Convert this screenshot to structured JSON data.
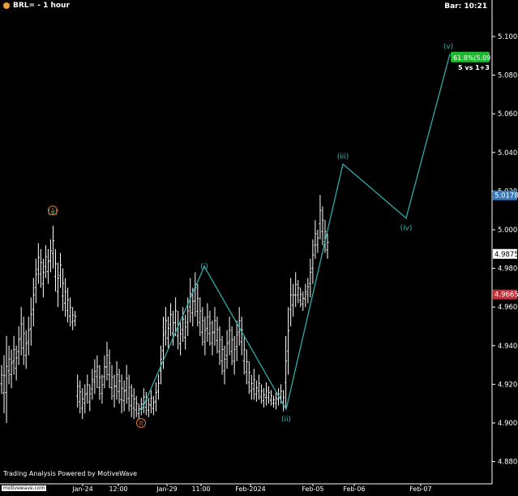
{
  "header": {
    "symbol_title": "BRL= - 1 hour",
    "bar_time": "Bar: 10:21"
  },
  "footer": {
    "credit": "Trading Analysis Powered by MotiveWave",
    "watermark": "motivewave.com"
  },
  "colors": {
    "background": "#000000",
    "wave": "#2fb8b8",
    "orange": "#e07a2a",
    "price_bars": "#ffffff",
    "last_price_box": "#3a78b8",
    "red_box": "#c0303a",
    "green_box": "#1fb830"
  },
  "chart_data": {
    "type": "ohlc",
    "y_axis": {
      "range": [
        4.875,
        5.108
      ],
      "ticks": [
        "5.1000",
        "5.0800",
        "5.0600",
        "5.0400",
        "5.0200",
        "5.0000",
        "4.9800",
        "4.9600",
        "4.9400",
        "4.9200",
        "4.9000",
        "4.8800"
      ]
    },
    "x_axis": {
      "tick_labels": [
        "Jan-24",
        "12:00",
        "Jan-29",
        "11:00",
        "Feb-2024",
        "Feb-05",
        "Feb-06",
        "Feb-07"
      ]
    },
    "price_labels": [
      {
        "value": 5.0178,
        "text": "5.0178",
        "style": "blue"
      },
      {
        "value": 4.9875,
        "text": "4.9875",
        "style": "white"
      },
      {
        "value": 4.9665,
        "text": "4.9665",
        "style": "red"
      }
    ],
    "projection_box": {
      "value": 5.09,
      "text": "61.8%(5.09",
      "note": "5 vs 1+3"
    },
    "wave_path": [
      {
        "label": "(ii)",
        "price": 4.906
      },
      {
        "label": "(i)",
        "price": 4.981
      },
      {
        "label": "(ii)",
        "price": 4.907
      },
      {
        "label": "(iii)",
        "price": 5.034
      },
      {
        "label": "(iv)",
        "price": 5.006
      },
      {
        "label": "(v)",
        "price": 5.091
      }
    ],
    "labels": [
      {
        "text": "(v)",
        "price": 5.009,
        "color": "teal"
      },
      {
        "text": "I",
        "price": 5.01,
        "color": "orange",
        "circled": true
      },
      {
        "text": "II",
        "price": 4.9,
        "color": "orange",
        "circled": true
      },
      {
        "text": "(i)",
        "price": 4.981,
        "color": "teal"
      },
      {
        "text": "(ii)",
        "price": 4.902,
        "color": "teal"
      },
      {
        "text": "(iii)",
        "price": 5.038,
        "color": "teal"
      },
      {
        "text": "(iv)",
        "price": 5.001,
        "color": "teal"
      },
      {
        "text": "(v)",
        "price": 5.095,
        "color": "teal"
      }
    ],
    "bars": [
      [
        4.93,
        4.915
      ],
      [
        4.935,
        4.905
      ],
      [
        4.945,
        4.9
      ],
      [
        4.94,
        4.92
      ],
      [
        4.938,
        4.918
      ],
      [
        4.945,
        4.925
      ],
      [
        4.94,
        4.922
      ],
      [
        4.95,
        4.93
      ],
      [
        4.96,
        4.935
      ],
      [
        4.955,
        4.93
      ],
      [
        4.948,
        4.928
      ],
      [
        4.955,
        4.935
      ],
      [
        4.965,
        4.94
      ],
      [
        4.975,
        4.95
      ],
      [
        4.985,
        4.962
      ],
      [
        4.993,
        4.972
      ],
      [
        4.99,
        4.97
      ],
      [
        4.985,
        4.965
      ],
      [
        4.992,
        4.975
      ],
      [
        4.99,
        4.972
      ],
      [
        4.995,
        4.978
      ],
      [
        5.002,
        4.98
      ],
      [
        4.99,
        4.968
      ],
      [
        4.983,
        4.96
      ],
      [
        4.988,
        4.97
      ],
      [
        4.98,
        4.958
      ],
      [
        4.975,
        4.955
      ],
      [
        4.97,
        4.952
      ],
      [
        4.965,
        4.95
      ],
      [
        4.96,
        4.948
      ],
      [
        4.958,
        4.95
      ],
      [
        4.925,
        4.908
      ],
      [
        4.922,
        4.905
      ],
      [
        4.918,
        4.902
      ],
      [
        4.92,
        4.905
      ],
      [
        4.925,
        4.91
      ],
      [
        4.92,
        4.906
      ],
      [
        4.928,
        4.912
      ],
      [
        4.933,
        4.915
      ],
      [
        4.935,
        4.918
      ],
      [
        4.93,
        4.912
      ],
      [
        4.925,
        4.91
      ],
      [
        4.935,
        4.918
      ],
      [
        4.942,
        4.922
      ],
      [
        4.938,
        4.918
      ],
      [
        4.93,
        4.912
      ],
      [
        4.925,
        4.908
      ],
      [
        4.932,
        4.912
      ],
      [
        4.928,
        4.91
      ],
      [
        4.925,
        4.905
      ],
      [
        4.922,
        4.906
      ],
      [
        4.93,
        4.91
      ],
      [
        4.925,
        4.906
      ],
      [
        4.92,
        4.903
      ],
      [
        4.918,
        4.902
      ],
      [
        4.914,
        4.903
      ],
      [
        4.91,
        4.902
      ],
      [
        4.913,
        4.904
      ],
      [
        4.918,
        4.905
      ],
      [
        4.916,
        4.904
      ],
      [
        4.913,
        4.903
      ],
      [
        4.917,
        4.905
      ],
      [
        4.914,
        4.904
      ],
      [
        4.921,
        4.906
      ],
      [
        4.925,
        4.912
      ],
      [
        4.94,
        4.92
      ],
      [
        4.955,
        4.928
      ],
      [
        4.96,
        4.94
      ],
      [
        4.955,
        4.938
      ],
      [
        4.962,
        4.945
      ],
      [
        4.958,
        4.94
      ],
      [
        4.965,
        4.945
      ],
      [
        4.958,
        4.938
      ],
      [
        4.952,
        4.935
      ],
      [
        4.96,
        4.942
      ],
      [
        4.956,
        4.938
      ],
      [
        4.965,
        4.945
      ],
      [
        4.975,
        4.952
      ],
      [
        4.97,
        4.95
      ],
      [
        4.978,
        4.955
      ],
      [
        4.972,
        4.95
      ],
      [
        4.965,
        4.945
      ],
      [
        4.96,
        4.94
      ],
      [
        4.955,
        4.935
      ],
      [
        4.962,
        4.942
      ],
      [
        4.958,
        4.94
      ],
      [
        4.953,
        4.935
      ],
      [
        4.96,
        4.94
      ],
      [
        4.955,
        4.936
      ],
      [
        4.95,
        4.93
      ],
      [
        4.945,
        4.925
      ],
      [
        4.94,
        4.92
      ],
      [
        4.948,
        4.928
      ],
      [
        4.955,
        4.935
      ],
      [
        4.95,
        4.93
      ],
      [
        4.945,
        4.925
      ],
      [
        4.953,
        4.932
      ],
      [
        4.96,
        4.94
      ],
      [
        4.955,
        4.935
      ],
      [
        4.945,
        4.925
      ],
      [
        4.938,
        4.92
      ],
      [
        4.932,
        4.915
      ],
      [
        4.925,
        4.912
      ],
      [
        4.928,
        4.912
      ],
      [
        4.922,
        4.911
      ],
      [
        4.925,
        4.912
      ],
      [
        4.92,
        4.91
      ],
      [
        4.918,
        4.908
      ],
      [
        4.921,
        4.909
      ],
      [
        4.919,
        4.91
      ],
      [
        4.917,
        4.909
      ],
      [
        4.914,
        4.908
      ],
      [
        4.916,
        4.907
      ],
      [
        4.918,
        4.909
      ],
      [
        4.92,
        4.91
      ],
      [
        4.917,
        4.906
      ],
      [
        4.945,
        4.908
      ],
      [
        4.96,
        4.925
      ],
      [
        4.975,
        4.95
      ],
      [
        4.972,
        4.955
      ],
      [
        4.978,
        4.96
      ],
      [
        4.974,
        4.962
      ],
      [
        4.97,
        4.96
      ],
      [
        4.968,
        4.958
      ],
      [
        4.972,
        4.96
      ],
      [
        4.975,
        4.962
      ],
      [
        4.985,
        4.965
      ],
      [
        4.995,
        4.972
      ],
      [
        5.005,
        4.985
      ],
      [
        5.0,
        4.988
      ],
      [
        5.018,
        4.995
      ],
      [
        5.012,
        4.992
      ],
      [
        5.005,
        4.988
      ],
      [
        4.998,
        4.985
      ]
    ]
  }
}
